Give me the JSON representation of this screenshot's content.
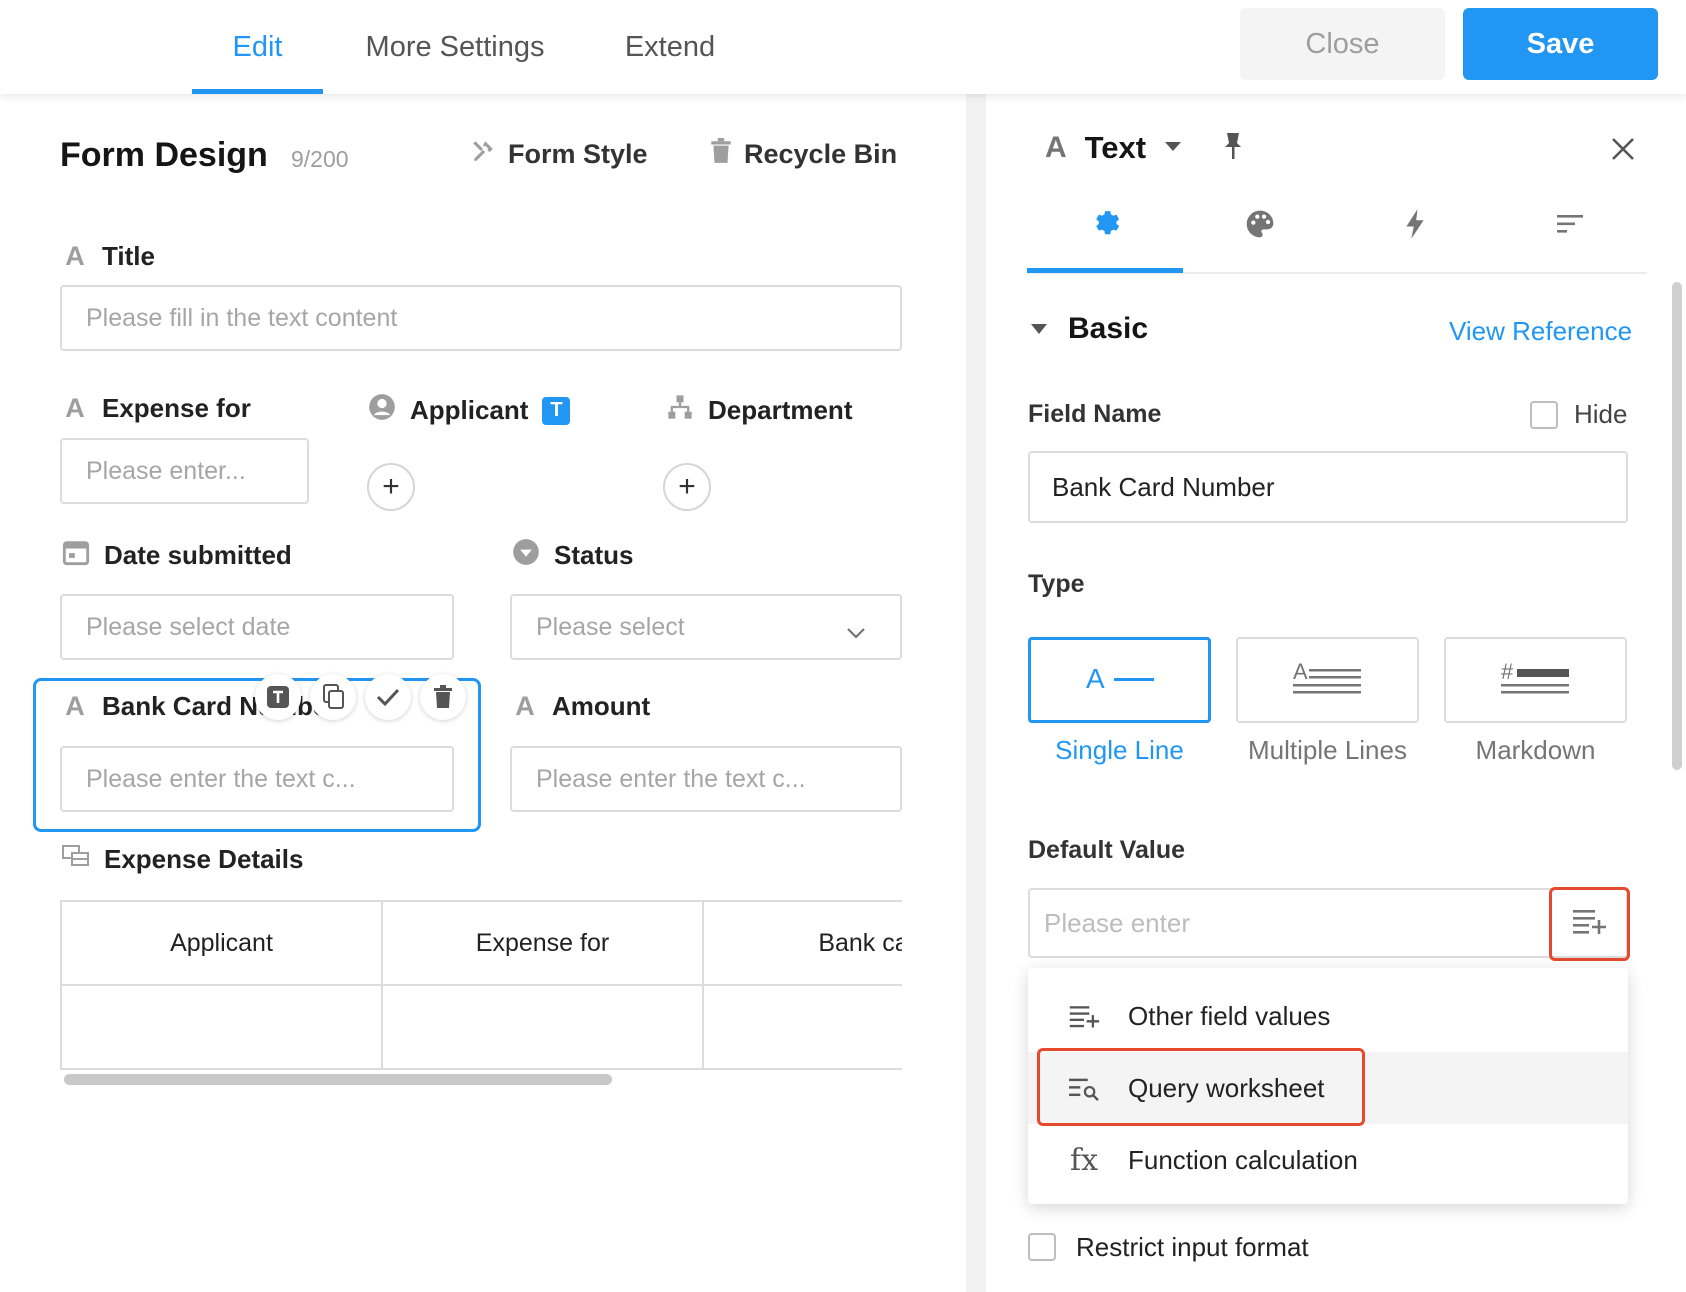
{
  "topbar": {
    "tabs": [
      {
        "label": "Edit",
        "active": true
      },
      {
        "label": "More Settings",
        "active": false
      },
      {
        "label": "Extend",
        "active": false
      }
    ],
    "close_label": "Close",
    "save_label": "Save"
  },
  "form": {
    "title": "Form Design",
    "count": "9/200",
    "form_style_label": "Form Style",
    "recycle_bin_label": "Recycle Bin",
    "fields": {
      "title": {
        "label": "Title",
        "placeholder": "Please fill in the text content"
      },
      "expense_for": {
        "label": "Expense for",
        "placeholder": "Please enter..."
      },
      "applicant": {
        "label": "Applicant",
        "badge": "T"
      },
      "department": {
        "label": "Department"
      },
      "date_submitted": {
        "label": "Date submitted",
        "placeholder": "Please select date"
      },
      "status": {
        "label": "Status",
        "placeholder": "Please select"
      },
      "bank_card": {
        "label": "Bank Card Number",
        "placeholder": "Please enter the text c..."
      },
      "amount": {
        "label": "Amount",
        "placeholder": "Please enter the text c..."
      },
      "expense_details": {
        "label": "Expense Details",
        "columns": [
          "Applicant",
          "Expense for",
          "Bank ca"
        ]
      }
    },
    "toolbar_icons": [
      "text-type-icon",
      "copy-icon",
      "check-icon",
      "trash-icon"
    ]
  },
  "panel": {
    "control_type": "Text",
    "tabs": [
      "gear-icon",
      "palette-icon",
      "lightning-icon",
      "sort-lines-icon"
    ],
    "section_title": "Basic",
    "view_reference": "View Reference",
    "field_name_label": "Field Name",
    "hide_label": "Hide",
    "field_name_value": "Bank Card Number",
    "type_label": "Type",
    "types": [
      {
        "label": "Single Line",
        "active": true
      },
      {
        "label": "Multiple Lines",
        "active": false
      },
      {
        "label": "Markdown",
        "active": false
      }
    ],
    "default_value_label": "Default Value",
    "default_value_placeholder": "Please enter",
    "dropdown": [
      {
        "label": "Other field values",
        "icon": "list-plus-icon"
      },
      {
        "label": "Query worksheet",
        "icon": "list-search-icon"
      },
      {
        "label": "Function calculation",
        "icon": "fx-icon"
      }
    ],
    "restrict_label": "Restrict input format"
  },
  "colors": {
    "accent": "#2196f3",
    "highlight": "#e64a2e"
  }
}
